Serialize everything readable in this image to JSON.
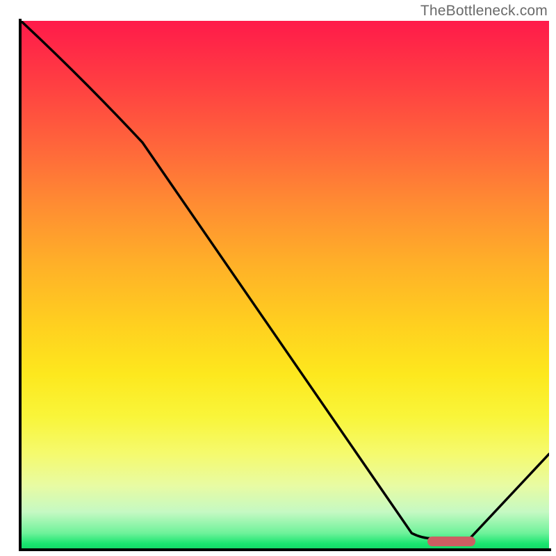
{
  "watermark": "TheBottleneck.com",
  "chart_data": {
    "type": "line",
    "title": "",
    "xlabel": "",
    "ylabel": "",
    "xlim": [
      0,
      100
    ],
    "ylim": [
      0,
      100
    ],
    "points": [
      {
        "x": 0,
        "y": 100
      },
      {
        "x": 23,
        "y": 77
      },
      {
        "x": 74,
        "y": 3
      },
      {
        "x": 78,
        "y": 2
      },
      {
        "x": 85,
        "y": 2
      },
      {
        "x": 100,
        "y": 18
      }
    ],
    "marker": {
      "x_start": 77,
      "x_end": 86,
      "y": 1.5
    },
    "gradient_stops": [
      {
        "pct": 0,
        "color": "#ff1a4a"
      },
      {
        "pct": 50,
        "color": "#ffd11f"
      },
      {
        "pct": 100,
        "color": "#14d867"
      }
    ],
    "curve": {
      "stroke": "#000000",
      "stroke_width": 3.5
    }
  }
}
